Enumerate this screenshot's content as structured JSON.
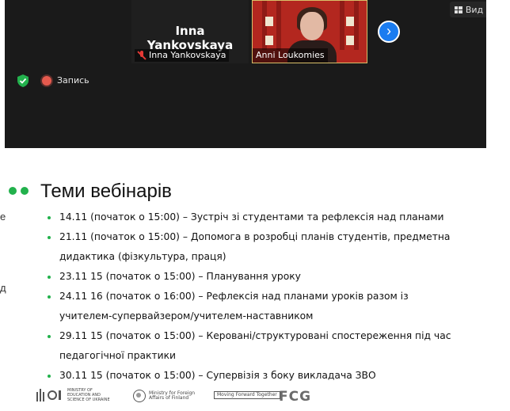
{
  "meeting": {
    "participants": [
      {
        "display_name": "Inna Yankovskaya",
        "label": "Inna Yankovskaya",
        "muted": true
      },
      {
        "label": "Anni Loukomies",
        "muted": false
      }
    ],
    "view_label": "Вид",
    "recording_label": "Запись",
    "next_icon": "chevron-right-icon",
    "view_icon": "grid-icon",
    "security_icon": "shield-check-icon"
  },
  "left_fragments": [
    "е",
    "д"
  ],
  "slide": {
    "title": "Теми вебінарів",
    "bullets": [
      "14.11 (початок о 15:00) – Зустріч зі студентами та рефлексія над планами",
      "21.11 (початок о 15:00) – Допомога в розробці планів студентів, предметна дидактика (фізкультура, праця)",
      "23.11 15 (початок о 15:00) – Планування уроку",
      "24.11 16 (початок о 16:00) – Рефлексія над планами уроків разом із учителем-супервайзером/учителем-наставником",
      "29.11 15 (початок о 15:00) – Керовані/структуровані спостереження під час педагогічної практики",
      "30.11 15 (початок о 15:00) – Супервізія з боку викладача ЗВО"
    ],
    "logos": {
      "moe": "Ministry of Education and Science of Ukraine",
      "mfa": "Ministry for Foreign Affairs of Finland",
      "mft": "Moving Forward Together",
      "fcg": "FCG"
    }
  },
  "colors": {
    "zoom_bg": "#1a1a1a",
    "accent_green": "#22b14c",
    "next_blue": "#1a7cf0",
    "record_red": "#e55a4e",
    "muted_red": "#e53935"
  }
}
